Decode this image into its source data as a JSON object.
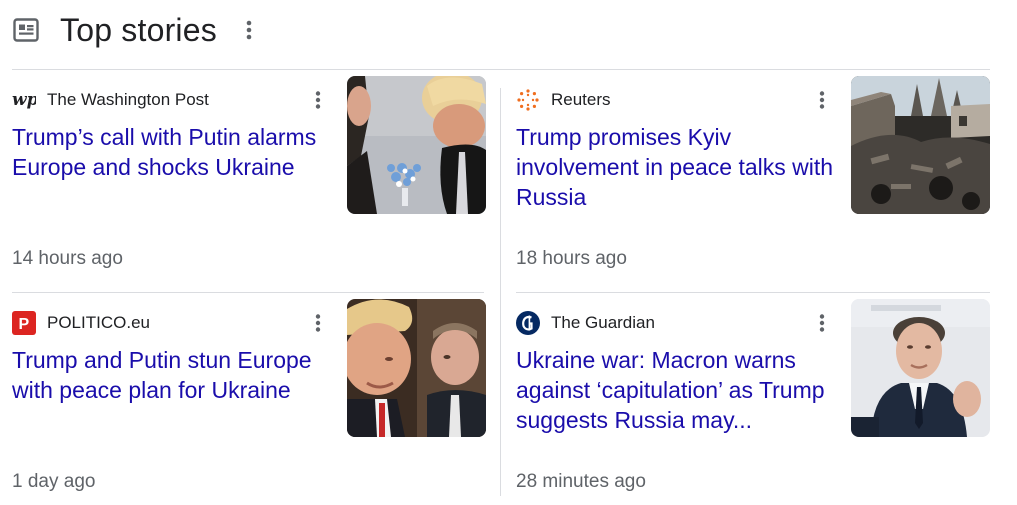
{
  "header": {
    "icon": "newspaper-icon",
    "title": "Top stories",
    "more_icon": "more-vert-icon"
  },
  "colors": {
    "headline": "#1a0dab",
    "title": "#202124",
    "meta": "#5f6368",
    "divider": "#dadce0"
  },
  "stories": [
    {
      "source": "The Washington Post",
      "logo_icon": "washington-post-logo-icon",
      "headline": "Trump’s call with Putin alarms Europe and shocks Ukraine",
      "time": "14 hours ago",
      "thumbnail": "two-men-and-flowers-thumbnail"
    },
    {
      "source": "Reuters",
      "logo_icon": "reuters-logo-icon",
      "headline": "Trump promises Kyiv involvement in peace talks with Russia",
      "time": "18 hours ago",
      "thumbnail": "destroyed-building-thumbnail"
    },
    {
      "source": "POLITICO.eu",
      "logo_icon": "politico-logo-icon",
      "headline": "Trump and Putin stun Europe with peace plan for Ukraine",
      "time": "1 day ago",
      "thumbnail": "trump-putin-thumbnail"
    },
    {
      "source": "The Guardian",
      "logo_icon": "guardian-logo-icon",
      "headline": "Ukraine war: Macron warns against ‘capitulation’ as Trump suggests Russia may...",
      "time": "28 minutes ago",
      "thumbnail": "macron-speaking-thumbnail"
    }
  ]
}
